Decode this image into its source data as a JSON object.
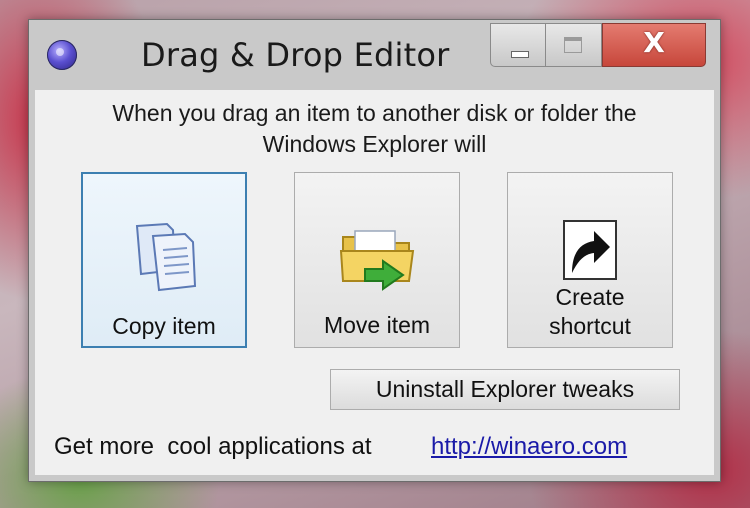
{
  "window": {
    "title": "Drag & Drop Editor",
    "icon": "app-orb-icon",
    "controls": {
      "minimize": "minimize-icon",
      "maximize": "maximize-icon",
      "close_glyph": "X"
    }
  },
  "prompt": {
    "line1": "When you drag an item to another disk or folder the",
    "line2": "Windows Explorer will"
  },
  "actions": [
    {
      "label": "Copy item",
      "icon": "copy-documents-icon",
      "focused": true
    },
    {
      "label": "Move item",
      "icon": "move-folder-icon",
      "focused": false
    },
    {
      "label_line1": "Create",
      "label_line2": "shortcut",
      "icon": "shortcut-arrow-icon",
      "focused": false
    }
  ],
  "uninstall_label": "Uninstall Explorer tweaks",
  "footer": {
    "text": "Get more  cool applications at",
    "link": "http://winaero.com"
  },
  "colors": {
    "link": "#1a1aa8",
    "focus_border": "#3c7fb1",
    "close_button": "#c7473b"
  }
}
